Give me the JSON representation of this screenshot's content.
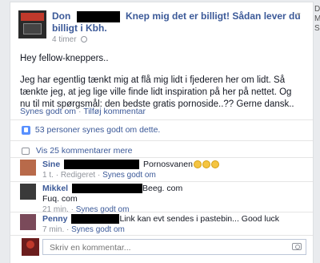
{
  "right_edge": {
    "line1": "D",
    "line2": "M",
    "line3": "S"
  },
  "post": {
    "author_first": "Don",
    "title": "Knep mig det er billigt! Sådan lever du billigt i Kbh.",
    "time": "4 timer",
    "paragraph1": "Hey fellow-kneppers..",
    "paragraph2": "Jeg har egentlig tænkt mig at flå mig lidt i fjederen her om lidt. Så tænkte jeg, at jeg lige ville finde lidt inspiration på her på nettet. Og nu til mit spørgsmål: den bedste gratis pornoside..?? Gerne dansk..",
    "like_label": "Synes godt om",
    "comment_label": "Tilføj kommentar",
    "separator": "·"
  },
  "likes": {
    "text": "53 personer synes godt om dette."
  },
  "more_comments": {
    "text": "Vis 25 kommentarer mere"
  },
  "comments": [
    {
      "name": "Sine",
      "text": "Pornosvanen",
      "meta_time": "1 t.",
      "meta_edited": "Redigeret",
      "like": "Synes godt om"
    },
    {
      "name": "Mikkel",
      "text": "Beeg. com",
      "text2": "Fuq. com",
      "meta_time": "21 min.",
      "like": "Synes godt om"
    },
    {
      "name": "Penny",
      "text": "Link kan evt sendes i pastebin... Good luck",
      "meta_time": "7 min.",
      "like": "Synes godt om"
    }
  ],
  "composer": {
    "placeholder": "Skriv en kommentar..."
  },
  "colors": {
    "link": "#3b5998",
    "meta": "#90949c",
    "like_icon": "#5890ff"
  }
}
